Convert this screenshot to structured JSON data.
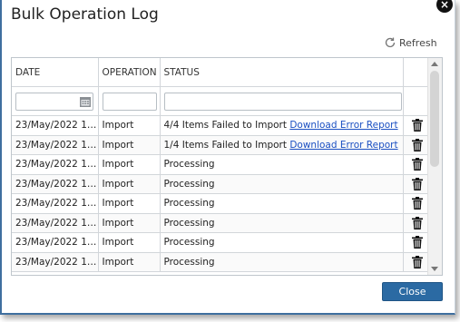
{
  "dialog": {
    "title": "Bulk Operation Log",
    "close_glyph": "×",
    "refresh_label": "Refresh",
    "close_button": "Close"
  },
  "table": {
    "columns": [
      "DATE",
      "OPERATION",
      "STATUS"
    ],
    "rows": [
      {
        "date": "23/May/2022 10:...",
        "operation": "Import",
        "status": "4/4 Items Failed to Import",
        "link": "Download Error Report"
      },
      {
        "date": "23/May/2022 10:...",
        "operation": "Import",
        "status": "1/4 Items Failed to Import",
        "link": "Download Error Report"
      },
      {
        "date": "23/May/2022 10:...",
        "operation": "Import",
        "status": "Processing",
        "link": ""
      },
      {
        "date": "23/May/2022 10:...",
        "operation": "Import",
        "status": "Processing",
        "link": ""
      },
      {
        "date": "23/May/2022 10:...",
        "operation": "Import",
        "status": "Processing",
        "link": ""
      },
      {
        "date": "23/May/2022 10:...",
        "operation": "Import",
        "status": "Processing",
        "link": ""
      },
      {
        "date": "23/May/2022 10:...",
        "operation": "Import",
        "status": "Processing",
        "link": ""
      },
      {
        "date": "23/May/2022 10:...",
        "operation": "Import",
        "status": "Processing",
        "link": ""
      }
    ]
  },
  "icons": {
    "refresh": "refresh-icon",
    "calendar": "calendar-icon",
    "delete": "trash-icon",
    "close": "close-icon"
  },
  "colors": {
    "primary_button": "#2b6aa3",
    "link": "#1a4fc2",
    "dialog_border": "#3f6f9f"
  }
}
